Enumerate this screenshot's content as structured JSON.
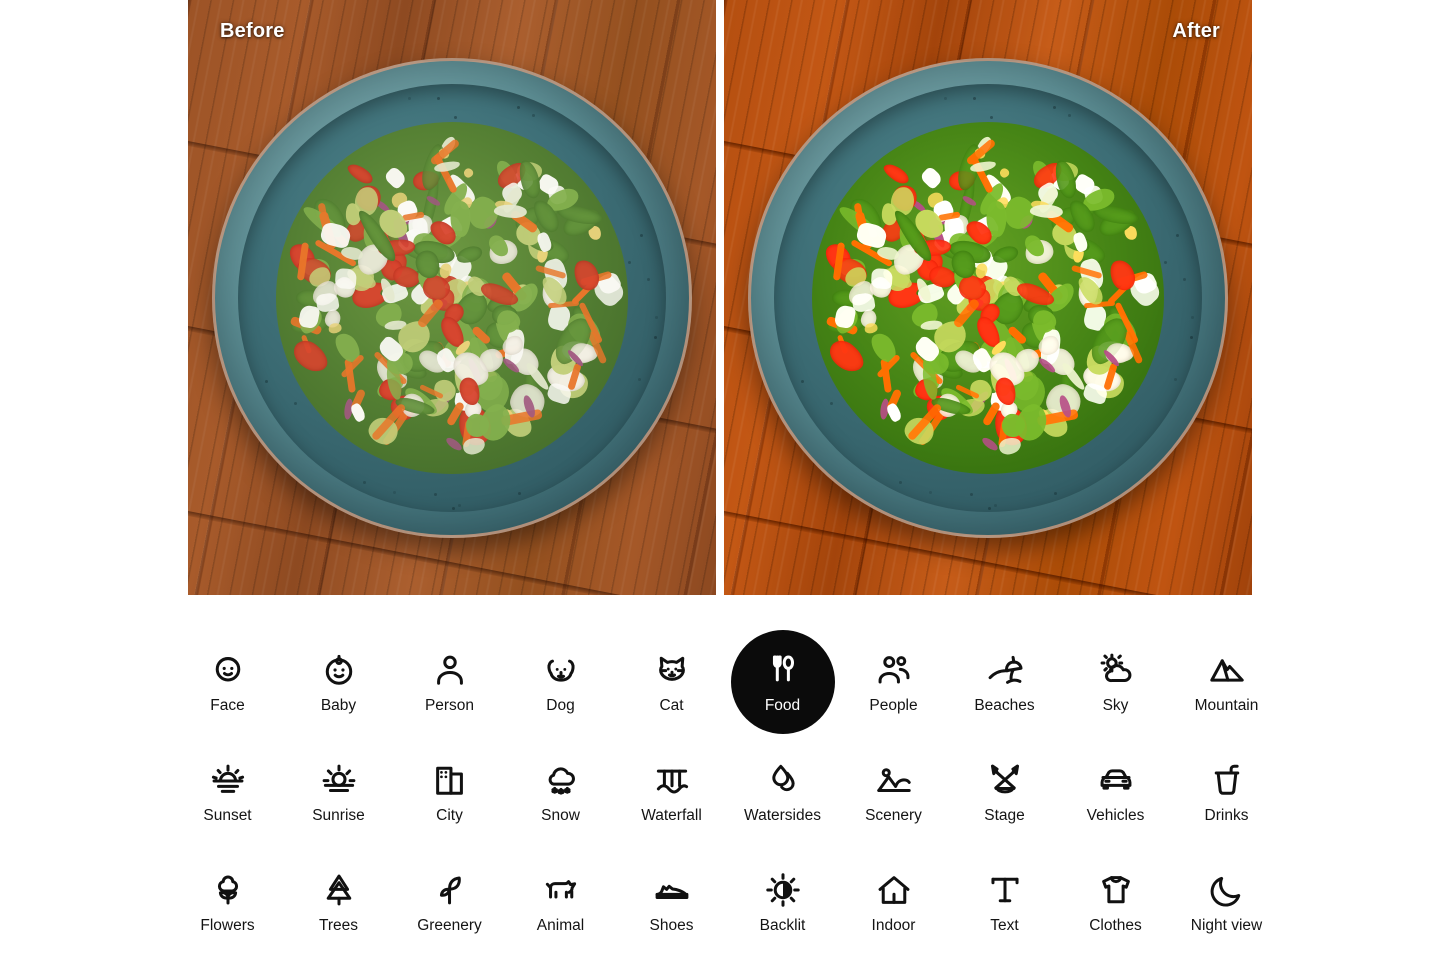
{
  "comparison": {
    "before_label": "Before",
    "after_label": "After",
    "subject": "overhead photo of a mixed salad on a teal ceramic plate on a wooden table",
    "label_color": "#ffffff"
  },
  "theme": {
    "page_background": "#ffffff",
    "selected_pill_background": "#0b0b0b",
    "selected_text": "#ffffff",
    "icon_color": "#111111",
    "label_color": "#141414"
  },
  "categories": {
    "columns": 10,
    "selected": "Food",
    "items": [
      {
        "label": "Face",
        "icon": "face-icon",
        "selected": false
      },
      {
        "label": "Baby",
        "icon": "baby-icon",
        "selected": false
      },
      {
        "label": "Person",
        "icon": "person-icon",
        "selected": false
      },
      {
        "label": "Dog",
        "icon": "dog-icon",
        "selected": false
      },
      {
        "label": "Cat",
        "icon": "cat-icon",
        "selected": false
      },
      {
        "label": "Food",
        "icon": "food-icon",
        "selected": true
      },
      {
        "label": "People",
        "icon": "people-icon",
        "selected": false
      },
      {
        "label": "Beaches",
        "icon": "beach-icon",
        "selected": false
      },
      {
        "label": "Sky",
        "icon": "sky-icon",
        "selected": false
      },
      {
        "label": "Mountain",
        "icon": "mountain-icon",
        "selected": false
      },
      {
        "label": "Sunset",
        "icon": "sunset-icon",
        "selected": false
      },
      {
        "label": "Sunrise",
        "icon": "sunrise-icon",
        "selected": false
      },
      {
        "label": "City",
        "icon": "city-icon",
        "selected": false
      },
      {
        "label": "Snow",
        "icon": "snow-icon",
        "selected": false
      },
      {
        "label": "Waterfall",
        "icon": "waterfall-icon",
        "selected": false
      },
      {
        "label": "Watersides",
        "icon": "watersides-icon",
        "selected": false
      },
      {
        "label": "Scenery",
        "icon": "scenery-icon",
        "selected": false
      },
      {
        "label": "Stage",
        "icon": "stage-icon",
        "selected": false
      },
      {
        "label": "Vehicles",
        "icon": "vehicles-icon",
        "selected": false
      },
      {
        "label": "Drinks",
        "icon": "drinks-icon",
        "selected": false
      },
      {
        "label": "Flowers",
        "icon": "flower-icon",
        "selected": false
      },
      {
        "label": "Trees",
        "icon": "tree-icon",
        "selected": false
      },
      {
        "label": "Greenery",
        "icon": "leaf-icon",
        "selected": false
      },
      {
        "label": "Animal",
        "icon": "animal-icon",
        "selected": false
      },
      {
        "label": "Shoes",
        "icon": "shoe-icon",
        "selected": false
      },
      {
        "label": "Backlit",
        "icon": "backlit-icon",
        "selected": false
      },
      {
        "label": "Indoor",
        "icon": "home-icon",
        "selected": false
      },
      {
        "label": "Text",
        "icon": "text-icon",
        "selected": false
      },
      {
        "label": "Clothes",
        "icon": "tshirt-icon",
        "selected": false
      },
      {
        "label": "Night view",
        "icon": "moon-icon",
        "selected": false
      }
    ]
  }
}
